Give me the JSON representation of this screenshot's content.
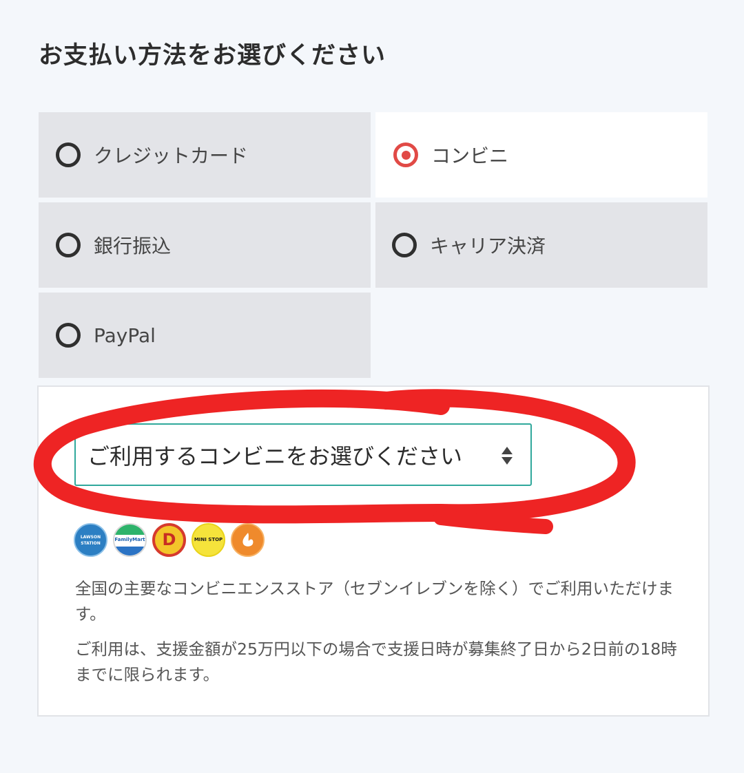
{
  "title": "お支払い方法をお選びください",
  "payment_options": [
    {
      "label": "クレジットカード",
      "selected": false
    },
    {
      "label": "コンビニ",
      "selected": true
    },
    {
      "label": "銀行振込",
      "selected": false
    },
    {
      "label": "キャリア決済",
      "selected": false
    },
    {
      "label": "PayPal",
      "selected": false
    }
  ],
  "convenience": {
    "select_value": "ご利用するコンビニをお選びください",
    "store_logos": [
      {
        "name": "lawson-station",
        "text": "LAWSON STATION"
      },
      {
        "name": "familymart",
        "text": "FamilyMart"
      },
      {
        "name": "daily-yamazaki",
        "text": "D"
      },
      {
        "name": "ministop",
        "text": "MINI STOP"
      },
      {
        "name": "seicomart",
        "text": ""
      }
    ],
    "description_1": "全国の主要なコンビニエンスストア（セブンイレブンを除く）でご利用いただけます。",
    "description_2": "ご利用は、支援金額が25万円以下の場合で支援日時が募集終了日から2日前の18時までに限られます。"
  },
  "colors": {
    "accent_red": "#e14a46",
    "select_border": "#2fa89b",
    "annotation_red": "#ee2424"
  }
}
